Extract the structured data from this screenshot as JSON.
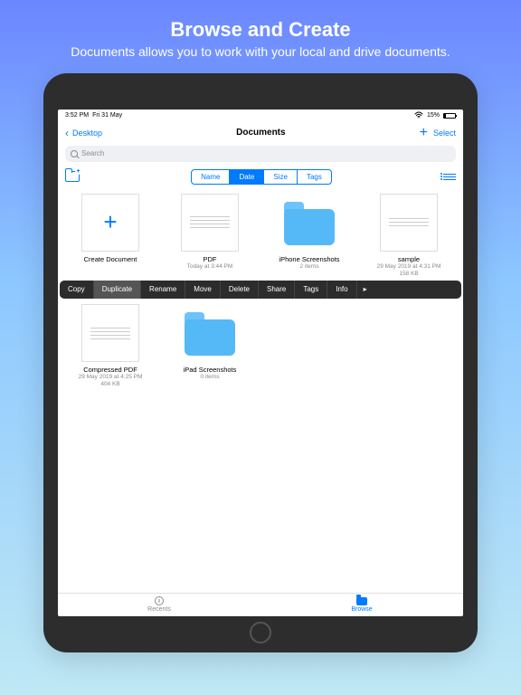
{
  "promo": {
    "title": "Browse and Create",
    "subtitle": "Documents allows you to work with your local and drive documents."
  },
  "statusbar": {
    "time": "3:52 PM",
    "date": "Fri 31 May",
    "battery_pct": "15%"
  },
  "nav": {
    "back_label": "Desktop",
    "title": "Documents",
    "select_label": "Select"
  },
  "search": {
    "placeholder": "Search"
  },
  "segmented": {
    "options": [
      "Name",
      "Date",
      "Size",
      "Tags"
    ],
    "active_index": 1
  },
  "items": [
    {
      "type": "create",
      "name": "Create Document",
      "meta": ""
    },
    {
      "type": "doc",
      "name": "PDF",
      "meta": "Today at 3:44 PM"
    },
    {
      "type": "folder",
      "name": "iPhone Screenshots",
      "meta": "2 items"
    },
    {
      "type": "doc",
      "name": "sample",
      "meta": "29 May 2019 at 4:31 PM\n158 KB"
    },
    {
      "type": "doc",
      "name": "Compressed PDF",
      "meta": "29 May 2019 at 4:25 PM\n404 KB"
    },
    {
      "type": "folder",
      "name": "iPad Screenshots",
      "meta": "0 items"
    }
  ],
  "context_menu": {
    "items": [
      "Copy",
      "Duplicate",
      "Rename",
      "Move",
      "Delete",
      "Share",
      "Tags",
      "Info"
    ],
    "highlighted_index": 1
  },
  "tabbar": {
    "tabs": [
      {
        "label": "Recents",
        "active": false
      },
      {
        "label": "Browse",
        "active": true
      }
    ]
  }
}
